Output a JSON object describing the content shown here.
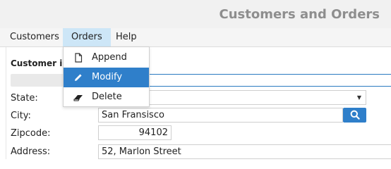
{
  "window": {
    "title": "Customers and Orders"
  },
  "menubar": {
    "items": [
      {
        "label": "Customers"
      },
      {
        "label": "Orders"
      },
      {
        "label": "Help"
      }
    ]
  },
  "orders_menu": {
    "items": [
      {
        "label": "Append",
        "icon": "document-icon"
      },
      {
        "label": "Modify",
        "icon": "pencil-icon",
        "selected": true
      },
      {
        "label": "Delete",
        "icon": "eraser-icon"
      }
    ]
  },
  "form": {
    "section_title": "Customer info",
    "state_label": "State:",
    "state_value": "",
    "city_label": "City:",
    "city_value": "San Fransisco",
    "zipcode_label": "Zipcode:",
    "zipcode_value": "94102",
    "address_label": "Address:",
    "address_value": "52, Marlon Street"
  },
  "colors": {
    "accent": "#2f7fca",
    "menu_active": "#cde6f7",
    "title_text": "#8e8e8e"
  }
}
